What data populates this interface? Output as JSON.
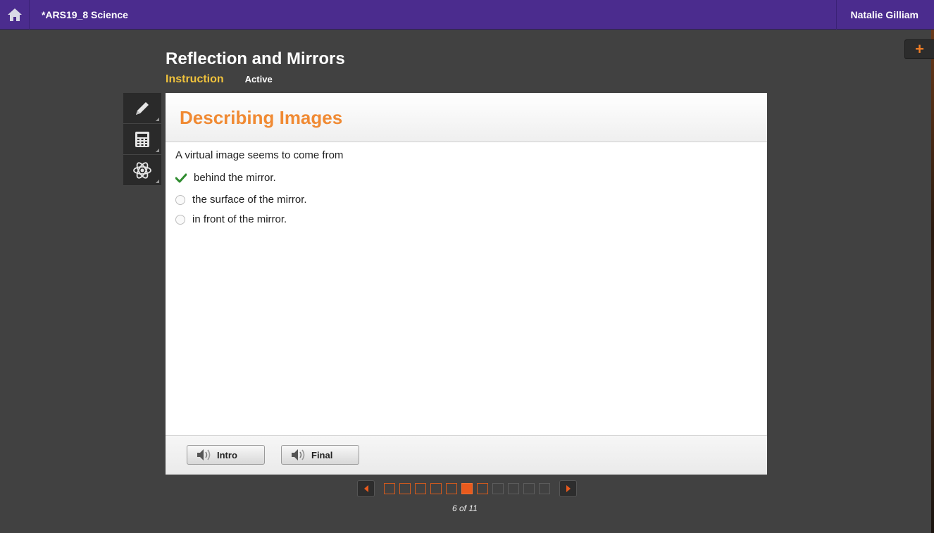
{
  "topbar": {
    "course_title": "*ARS19_8 Science",
    "user_name": "Natalie Gilliam"
  },
  "lesson": {
    "title": "Reflection and Mirrors",
    "tab_instruction": "Instruction",
    "status": "Active"
  },
  "tools": [
    "pencil-icon",
    "calculator-icon",
    "atom-icon"
  ],
  "panel": {
    "title": "Describing Images",
    "question": "A virtual image seems to come from",
    "options": [
      {
        "label": "behind the mirror.",
        "state": "correct"
      },
      {
        "label": "the surface of the mirror.",
        "state": "unselected"
      },
      {
        "label": "in front of the mirror.",
        "state": "unselected"
      }
    ],
    "audio_buttons": [
      "Intro",
      "Final"
    ]
  },
  "pager": {
    "total": 11,
    "current": 6,
    "visited": 7,
    "label": "6 of 11"
  },
  "colors": {
    "topbar": "#4b2c8e",
    "accent_orange": "#f08a33",
    "tab_yellow": "#f0c23c",
    "check_green": "#2e8b2e",
    "background": "#414141"
  }
}
